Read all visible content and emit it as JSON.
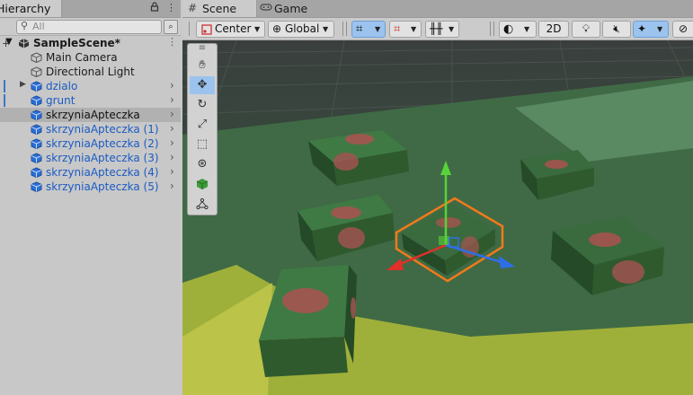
{
  "hierarchy": {
    "tab_title": "Hierarchy",
    "add_label": "+",
    "lock_icon": "lock-icon",
    "more_label": "⋮",
    "search_placeholder": "All",
    "scene_name": "SampleScene*",
    "items": [
      {
        "label": "Main Camera",
        "prefab": false,
        "has_children": false
      },
      {
        "label": "Directional Light",
        "prefab": false,
        "has_children": false
      },
      {
        "label": "dzialo",
        "prefab": true,
        "has_children": true
      },
      {
        "label": "grunt",
        "prefab": true,
        "has_children": false
      },
      {
        "label": "skrzyniaApteczka",
        "prefab": true,
        "has_children": false,
        "selected": true
      },
      {
        "label": "skrzyniaApteczka (1)",
        "prefab": true,
        "has_children": false
      },
      {
        "label": "skrzyniaApteczka (2)",
        "prefab": true,
        "has_children": false
      },
      {
        "label": "skrzyniaApteczka (3)",
        "prefab": true,
        "has_children": false
      },
      {
        "label": "skrzyniaApteczka (4)",
        "prefab": true,
        "has_children": false
      },
      {
        "label": "skrzyniaApteczka (5)",
        "prefab": true,
        "has_children": false
      }
    ]
  },
  "scene": {
    "tabs": [
      {
        "label": "Scene",
        "icon": "grid-icon",
        "active": true
      },
      {
        "label": "Game",
        "icon": "gamepad-icon",
        "active": false
      }
    ],
    "toolbar": {
      "pivot_label": "Center",
      "space_label": "Global",
      "mode_2d_label": "2D"
    },
    "colors": {
      "selection_outline": "#f07a1a",
      "axis_x": "#e0302a",
      "axis_y": "#58d23a",
      "axis_z": "#2f6ee8",
      "ground": "#3f6a45",
      "terrain": "#9fb03a",
      "sky": "#2e3a36",
      "crate": "#2f5a2e"
    }
  }
}
